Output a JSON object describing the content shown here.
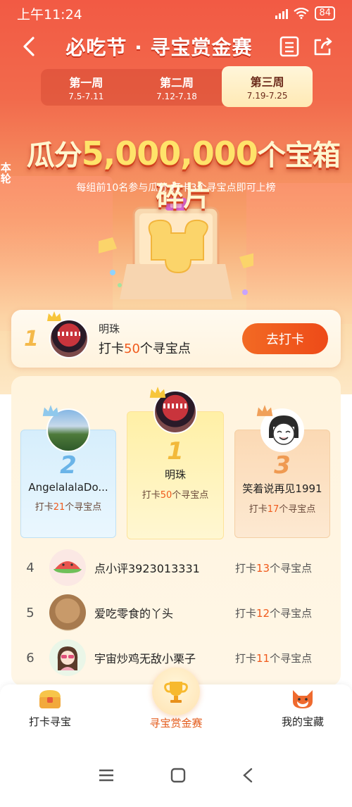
{
  "status_bar": {
    "time": "上午11:24",
    "battery": "84"
  },
  "nav": {
    "title": "必吃节 · 寻宝赏金赛"
  },
  "tabs": [
    {
      "label": "第一周",
      "date": "7.5-7.11"
    },
    {
      "label": "第二周",
      "date": "7.12-7.18"
    },
    {
      "label": "第三周",
      "date": "7.19-7.25"
    }
  ],
  "headline": {
    "prefix": "本轮",
    "text_before": "瓜分",
    "amount": "5,000,000",
    "text_after": "个宝箱碎片",
    "subline": "每组前10名参与瓜分  打卡3个寻宝点即可上榜"
  },
  "my_rank": {
    "rank": "1",
    "name": "明珠",
    "count_prefix": "打卡",
    "count": "50",
    "count_suffix": "个寻宝点",
    "button": "去打卡"
  },
  "podium": [
    {
      "rank": "2",
      "name": "AngelalalaDo...",
      "prefix": "打卡",
      "count": "21",
      "suffix": "个寻宝点"
    },
    {
      "rank": "1",
      "name": "明珠",
      "prefix": "打卡",
      "count": "50",
      "suffix": "个寻宝点"
    },
    {
      "rank": "3",
      "name": "笑着说再见1991",
      "prefix": "打卡",
      "count": "17",
      "suffix": "个寻宝点"
    }
  ],
  "ranking": [
    {
      "rank": "4",
      "name": "点小评3923013331",
      "prefix": "打卡",
      "count": "13",
      "suffix": "个寻宝点"
    },
    {
      "rank": "5",
      "name": "爱吃零食的丫头",
      "prefix": "打卡",
      "count": "12",
      "suffix": "个寻宝点"
    },
    {
      "rank": "6",
      "name": "宇宙炒鸡无敌小栗子",
      "prefix": "打卡",
      "count": "11",
      "suffix": "个寻宝点"
    }
  ],
  "tabbar": [
    {
      "label": "打卡寻宝",
      "icon": "treasure-chest-icon"
    },
    {
      "label": "寻宝赏金赛",
      "icon": "trophy-icon"
    },
    {
      "label": "我的宝藏",
      "icon": "fox-icon"
    }
  ],
  "colors": {
    "accent": "#f05a1c",
    "gold": "#f4b94a",
    "hero_top": "#f25a44"
  }
}
